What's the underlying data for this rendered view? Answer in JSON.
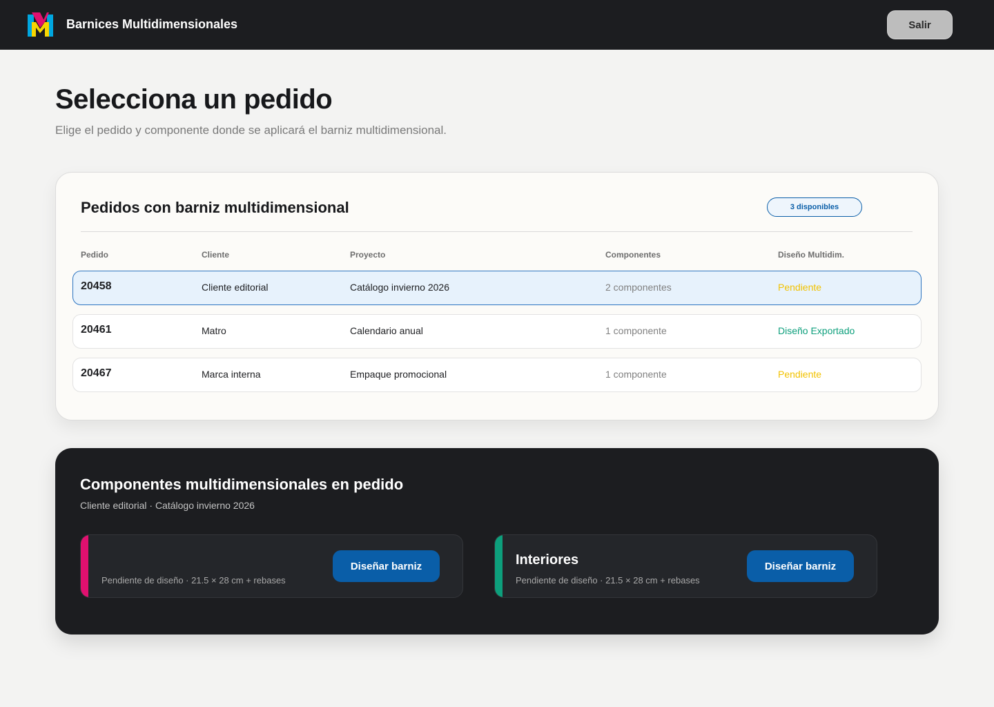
{
  "header": {
    "brand": "Barnices Multidimensionales",
    "logout_label": "Salir"
  },
  "page": {
    "title": "Selecciona un pedido",
    "subtitle": "Elige el pedido y componente donde se aplicará el barniz multidimensional."
  },
  "orders": {
    "title": "Pedidos con barniz multidimensional",
    "badge": "3 disponibles",
    "columns": [
      "Pedido",
      "Cliente",
      "Proyecto",
      "Componentes",
      "Diseño Multidim."
    ],
    "rows": [
      {
        "id": "20458",
        "client": "Cliente editorial",
        "project": "Catálogo invierno 2026",
        "components": "2 componentes",
        "status": "Pendiente",
        "selected": true
      },
      {
        "id": "20461",
        "client": "Matro",
        "project": "Calendario anual",
        "components": "1 componente",
        "status": "Diseño Exportado",
        "selected": false
      },
      {
        "id": "20467",
        "client": "Marca interna",
        "project": "Empaque promocional",
        "components": "1 componente",
        "status": "Pendiente",
        "selected": false
      }
    ]
  },
  "components": {
    "title": "Componentes multidimensionales en pedido",
    "subtitle": "Cliente editorial · Catálogo invierno 2026",
    "items": [
      {
        "name": "",
        "meta": "Pendiente de diseño · 21.5 × 28 cm + rebases",
        "button": "Diseñar barniz",
        "accent": "#e0106f"
      },
      {
        "name": "Interiores",
        "meta": "Pendiente de diseño · 21.5 × 28 cm + rebases",
        "button": "Diseñar barniz",
        "accent": "#0d9f7c"
      }
    ]
  },
  "colors": {
    "pending": "#f2c200",
    "exported": "#0d9f7c",
    "primary": "#0a5ea8"
  }
}
